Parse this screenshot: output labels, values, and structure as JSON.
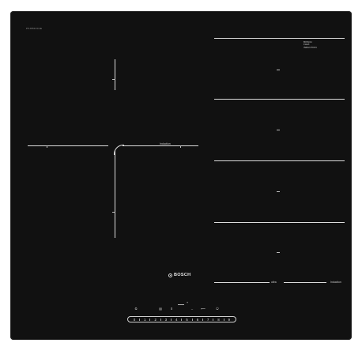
{
  "cooktop": {
    "model_code": "PXJ651FC1E",
    "brand": "BOSCH",
    "combi_label": "Induction",
    "flex_zone_labels": [
      "",
      "",
      "",
      ""
    ],
    "right_brand_lines": [
      "BOSCH",
      "FLEX",
      "INDUCTION"
    ],
    "bottom_right_labels": [
      "ultra",
      "Induction"
    ],
    "controls": {
      "timer_label": "",
      "memory_label": "Memory",
      "boost_label": "Boost",
      "plus_label": "+",
      "minus_label": "–",
      "fast_label": "",
      "power_label": "⏻"
    },
    "slider_values": [
      "0",
      "1",
      "2",
      "3",
      "4",
      "5",
      "6",
      "7",
      "8",
      "9"
    ]
  }
}
